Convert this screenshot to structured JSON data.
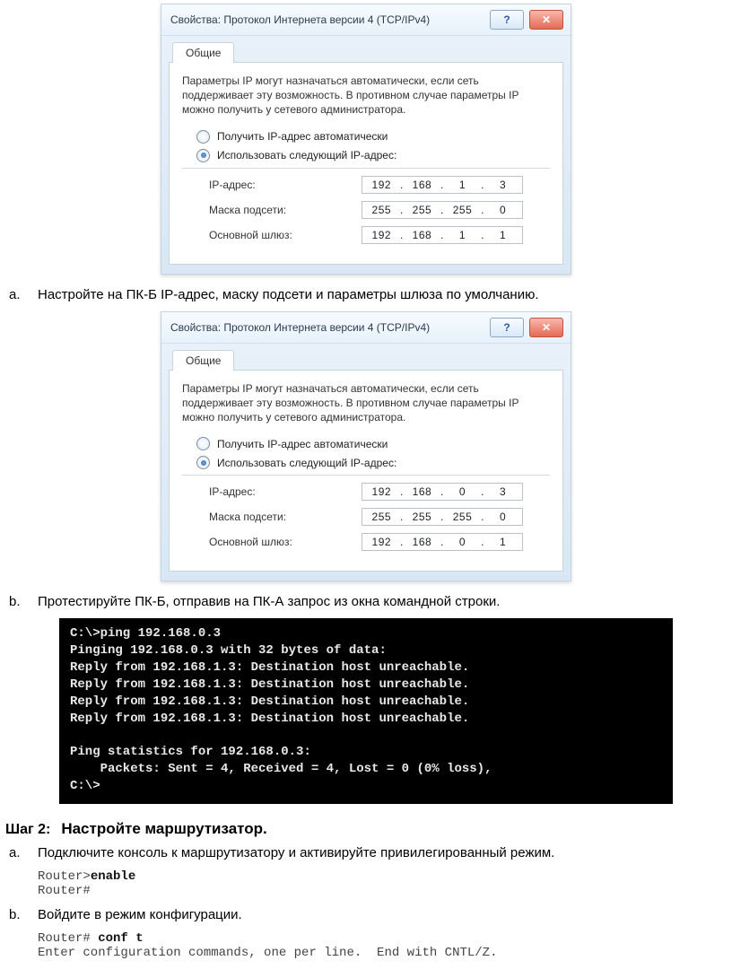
{
  "dialog1": {
    "title": "Свойства: Протокол Интернета версии 4 (TCP/IPv4)",
    "tab": "Общие",
    "desc": "Параметры IP могут назначаться автоматически, если сеть поддерживает эту возможность. В противном случае параметры IP можно получить у сетевого администратора.",
    "radio_auto": "Получить IP-адрес автоматически",
    "radio_manual": "Использовать следующий IP-адрес:",
    "label_ip": "IP-адрес:",
    "label_mask": "Маска подсети:",
    "label_gw": "Основной шлюз:",
    "ip": {
      "a": "192",
      "b": "168",
      "c": "1",
      "d": "3"
    },
    "mask": {
      "a": "255",
      "b": "255",
      "c": "255",
      "d": "0"
    },
    "gw": {
      "a": "192",
      "b": "168",
      "c": "1",
      "d": "1"
    }
  },
  "item_a": "Настройте на ПК-Б IP-адрес, маску подсети и параметры шлюза по умолчанию.",
  "dialog2": {
    "title": "Свойства: Протокол Интернета версии 4 (TCP/IPv4)",
    "tab": "Общие",
    "desc": "Параметры IP могут назначаться автоматически, если сеть поддерживает эту возможность. В противном случае параметры IP можно получить у сетевого администратора.",
    "radio_auto": "Получить IP-адрес автоматически",
    "radio_manual": "Использовать следующий IP-адрес:",
    "label_ip": "IP-адрес:",
    "label_mask": "Маска подсети:",
    "label_gw": "Основной шлюз:",
    "ip": {
      "a": "192",
      "b": "168",
      "c": "0",
      "d": "3"
    },
    "mask": {
      "a": "255",
      "b": "255",
      "c": "255",
      "d": "0"
    },
    "gw": {
      "a": "192",
      "b": "168",
      "c": "0",
      "d": "1"
    }
  },
  "item_b": "Протестируйте ПК-Б, отправив на ПК-А запрос из окна командной строки.",
  "cmd": "C:\\>ping 192.168.0.3\nPinging 192.168.0.3 with 32 bytes of data:\nReply from 192.168.1.3: Destination host unreachable.\nReply from 192.168.1.3: Destination host unreachable.\nReply from 192.168.1.3: Destination host unreachable.\nReply from 192.168.1.3: Destination host unreachable.\n\nPing statistics for 192.168.0.3:\n    Packets: Sent = 4, Received = 4, Lost = 0 (0% loss),\nC:\\>",
  "step2_label": "Шаг 2:",
  "step2_title": "Настройте маршрутизатор.",
  "s2a_text": "Подключите консоль к маршрутизатору и активируйте привилегированный режим.",
  "s2a_code1_prompt": "Router>",
  "s2a_code1_cmd": "enable",
  "s2a_code2": "Router#",
  "s2b_text": "Войдите в режим конфигурации.",
  "s2b_code1_prompt": "Router# ",
  "s2b_code1_cmd": "conf t",
  "s2b_code2": "Enter configuration commands, one per line.  End with CNTL/Z.",
  "markers": {
    "a": "a.",
    "b": "b."
  }
}
